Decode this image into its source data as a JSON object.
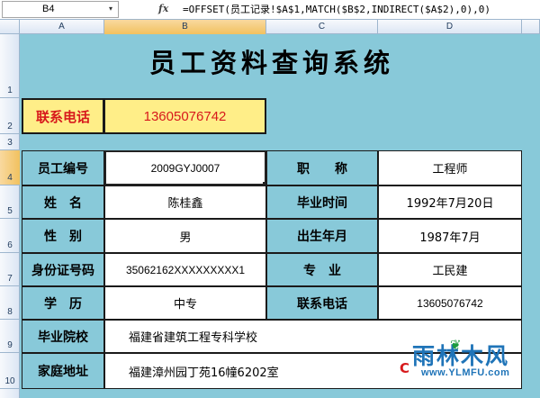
{
  "formula_bar": {
    "name_box": "B4",
    "dropdown_icon": "▾",
    "fx_icon": "fx",
    "formula": "=OFFSET(员工记录!$A$1,MATCH($B$2,INDIRECT($A$2),0),0)"
  },
  "columns": [
    "A",
    "B",
    "C",
    "D"
  ],
  "rows": [
    "1",
    "2",
    "3",
    "4",
    "5",
    "6",
    "7",
    "8",
    "9",
    "10"
  ],
  "selection": {
    "column": "B",
    "row": "4"
  },
  "title": "员工资料查询系统",
  "search": {
    "label": "联系电话",
    "value": "13605076742"
  },
  "fields": {
    "emp_id_label": "员工编号",
    "emp_id_value": "2009GYJ0007",
    "title_label": "职　　称",
    "title_value": "工程师",
    "name_label": "姓　名",
    "name_value": "陈桂鑫",
    "grad_time_label": "毕业时间",
    "grad_time_value": "1992年7月20日",
    "gender_label": "性　别",
    "gender_value": "男",
    "birth_label": "出生年月",
    "birth_value": "1987年7月",
    "id_label": "身份证号码",
    "id_value": "35062162XXXXXXXXX1",
    "major_label": "专　业",
    "major_value": "工民建",
    "edu_label": "学　历",
    "edu_value": "中专",
    "phone_label": "联系电话",
    "phone_value": "13605076742",
    "school_label": "毕业院校",
    "school_value": "福建省建筑工程专科学校",
    "address_label": "家庭地址",
    "address_value": "福建漳州园丁苑16幢6202室"
  },
  "watermark": {
    "name": "雨林木风",
    "leaf": "❦",
    "url": "www.YLMFU.com",
    "red_mark": "C"
  },
  "colors": {
    "sheet_bg": "#88c9d9",
    "highlight": "#ffee88",
    "accent_red": "#d7191c",
    "watermark_blue": "#1f74b8"
  }
}
